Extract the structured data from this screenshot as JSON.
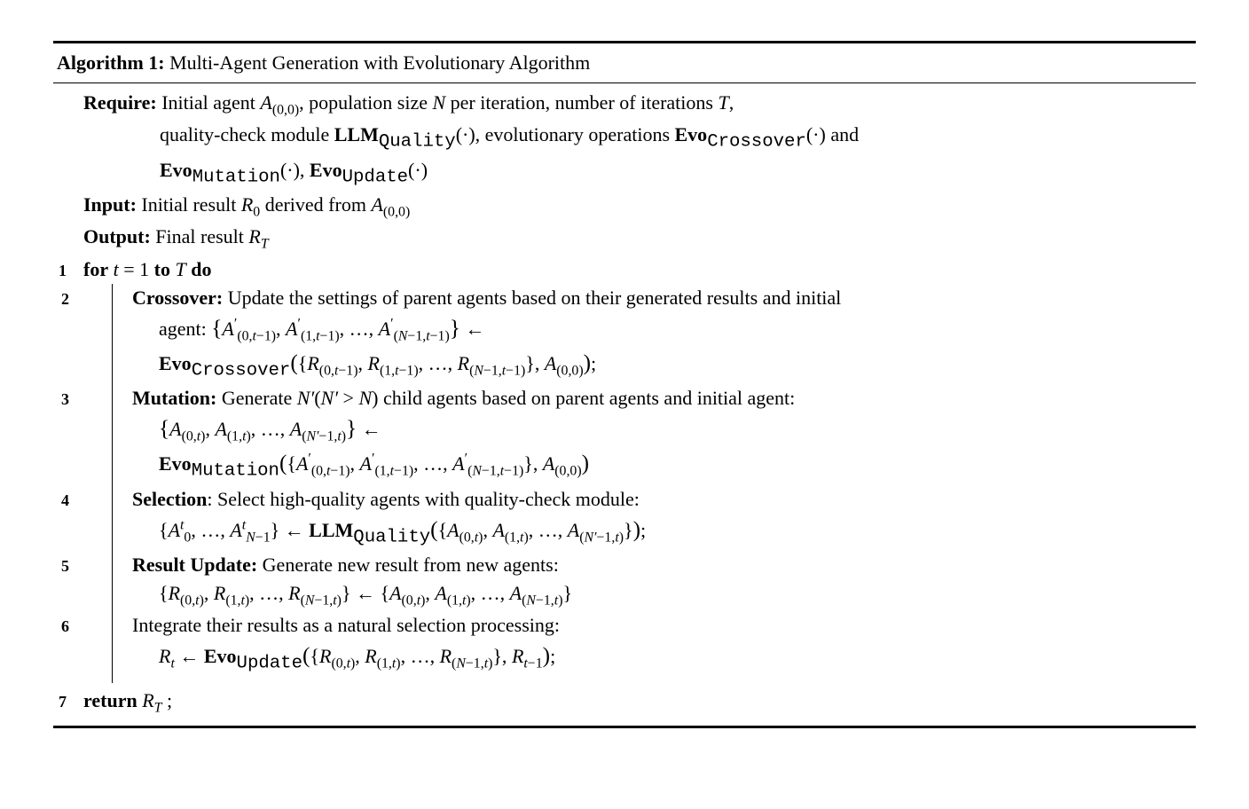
{
  "algorithm": {
    "label": "Algorithm 1:",
    "title": "Multi-Agent Generation with Evolutionary Algorithm",
    "require_label": "Require:",
    "require_line1": "Initial agent A_{(0,0)}, population size N per iteration, number of iterations T,",
    "require_line2": "quality-check module LLM_{Quality}(·), evolutionary operations Evo_{Crossover}(·) and",
    "require_line3": "Evo_{Mutation}(·), Evo_{Update}(·)",
    "input_label": "Input:",
    "input_text": "Initial result R_0 derived from A_{(0,0)}",
    "output_label": "Output:",
    "output_text": "Final result R_T",
    "for_label": "for",
    "for_cond": "t = 1 to T",
    "do_label": "do",
    "step2_label": "Crossover:",
    "step2_text": "Update the settings of parent agents based on their generated results and initial",
    "step2_cont1": "agent: {A'_{(0,t−1)}, A'_{(1,t−1)}, …, A'_{(N−1,t−1)}} ←",
    "step2_cont2": "Evo_{Crossover}({R_{(0,t−1)}, R_{(1,t−1)}, …, R_{(N−1,t−1)}}, A_{(0,0)});",
    "step3_label": "Mutation:",
    "step3_text": "Generate N'(N' > N) child agents based on parent agents and initial agent:",
    "step3_cont1": "{A_{(0,t)}, A_{(1,t)}, …, A_{(N'−1,t)}} ←",
    "step3_cont2": "Evo_{Mutation}({A'_{(0,t−1)}, A'_{(1,t−1)}, …, A'_{(N−1,t−1)}}, A_{(0,0)})",
    "step4_label": "Selection",
    "step4_colon": ":",
    "step4_text": "Select high-quality agents with quality-check module:",
    "step4_cont1": "{A_0^t, …, A_{N−1}^t} ← LLM_{Quality}({A_{(0,t)}, A_{(1,t)}, …, A_{(N'−1,t)}});",
    "step5_label": "Result Update:",
    "step5_text": "Generate new result from new agents:",
    "step5_cont1": "{R_{(0,t)}, R_{(1,t)}, …, R_{(N−1,t)}} ← {A_{(0,t)}, A_{(1,t)}, …, A_{(N−1,t)}}",
    "step6_text": "Integrate their results as a natural selection processing:",
    "step6_cont1": "R_t ← Evo_{Update}({R_{(0,t)}, R_{(1,t)}, …, R_{(N−1,t)}}, R_{t−1});",
    "return_label": "return",
    "return_text": "R_T ;",
    "line_numbers": [
      "1",
      "2",
      "3",
      "4",
      "5",
      "6",
      "7"
    ]
  }
}
